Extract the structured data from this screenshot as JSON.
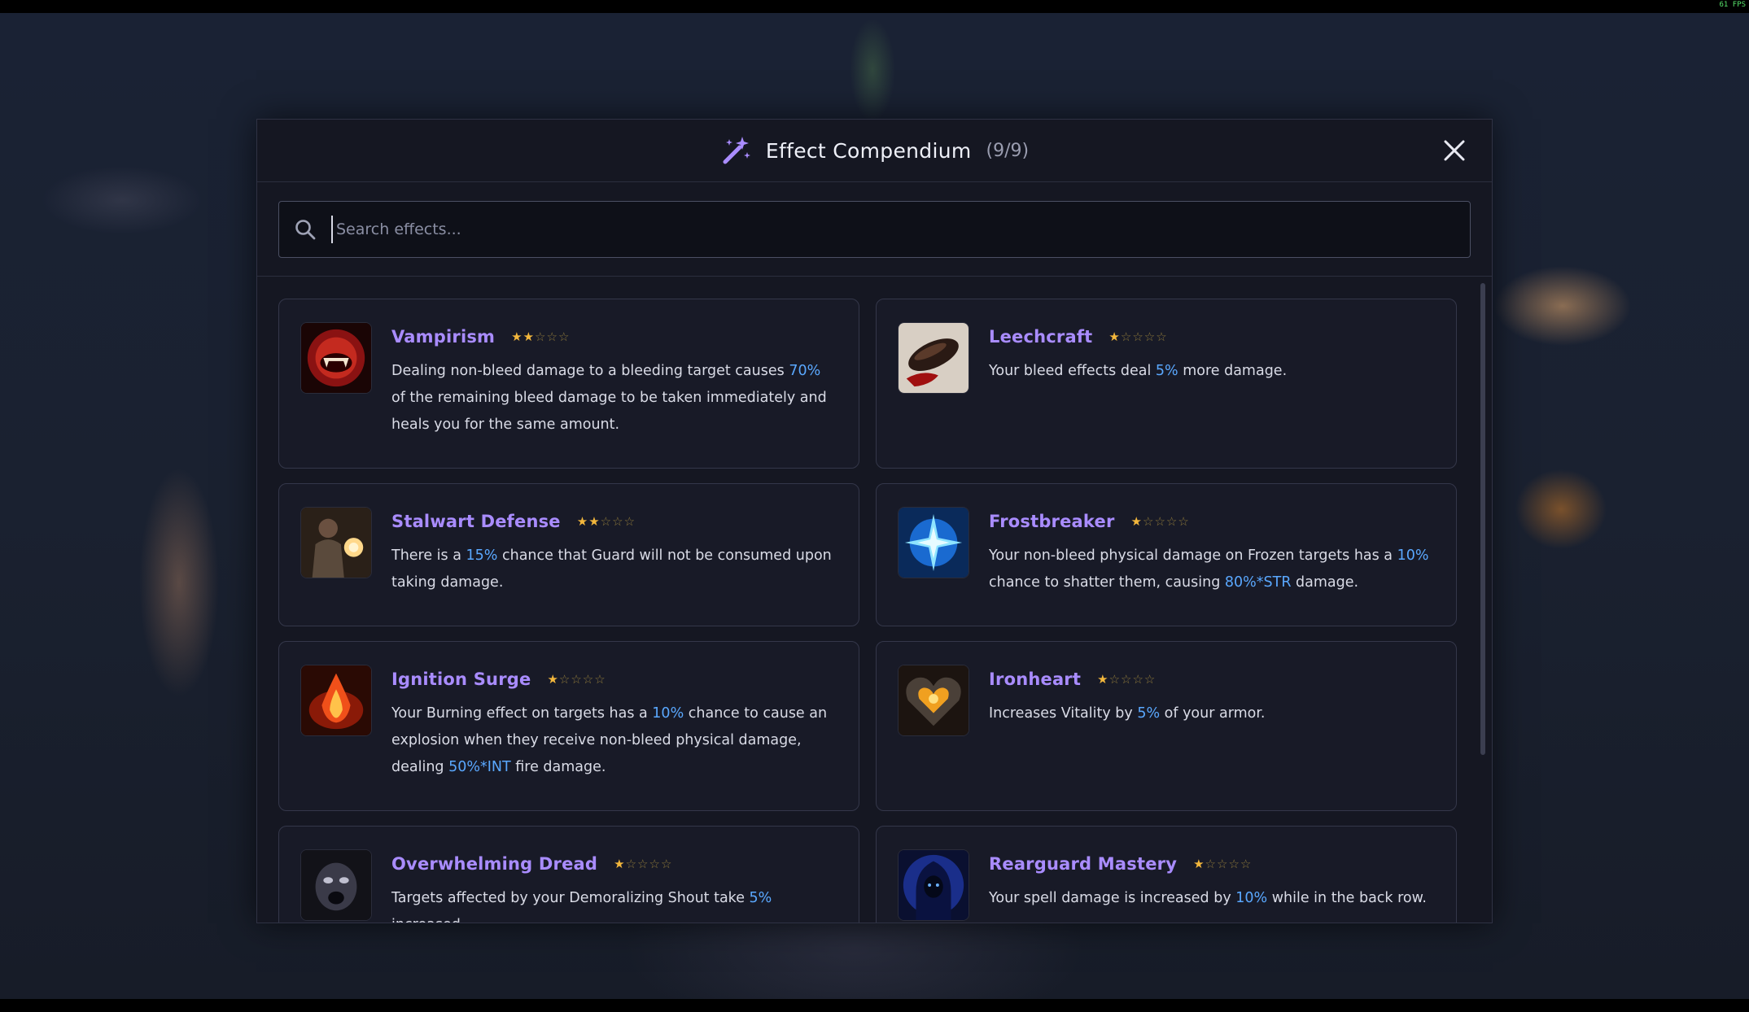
{
  "fps": "61 FPS",
  "modal": {
    "title": "Effect Compendium",
    "count": "(9/9)",
    "close_icon": "close-icon",
    "header_icon": "magic-wand-icon"
  },
  "search": {
    "placeholder": "Search effects...",
    "value": ""
  },
  "colors": {
    "accent_title": "#a98cff",
    "highlight": "#5aa8ff",
    "star": "#f3b73c"
  },
  "effects": [
    {
      "name": "Vampirism",
      "stars_filled": 2,
      "stars_total": 5,
      "icon": "vampire-fangs-icon",
      "desc": [
        "Dealing non-bleed damage to a bleeding target causes ",
        "70%",
        " of the remaining bleed damage to be taken immediately and heals you for the same amount."
      ]
    },
    {
      "name": "Leechcraft",
      "stars_filled": 1,
      "stars_total": 5,
      "icon": "leech-icon",
      "desc": [
        "Your bleed effects deal ",
        "5%",
        " more damage."
      ]
    },
    {
      "name": "Stalwart Defense",
      "stars_filled": 2,
      "stars_total": 5,
      "icon": "armored-knight-icon",
      "desc": [
        "There is a ",
        "15%",
        " chance that Guard will not be consumed upon taking damage."
      ]
    },
    {
      "name": "Frostbreaker",
      "stars_filled": 1,
      "stars_total": 5,
      "icon": "ice-shatter-icon",
      "desc": [
        "Your non-bleed physical damage on Frozen targets has a ",
        "10%",
        " chance to shatter them, causing ",
        "80%*STR",
        " damage."
      ]
    },
    {
      "name": "Ignition Surge",
      "stars_filled": 1,
      "stars_total": 5,
      "icon": "fire-explosion-icon",
      "desc": [
        "Your Burning effect on targets has a ",
        "10%",
        " chance to cause an explosion when they receive non-bleed physical damage, dealing ",
        "50%*INT",
        " fire damage."
      ]
    },
    {
      "name": "Ironheart",
      "stars_filled": 1,
      "stars_total": 5,
      "icon": "iron-heart-icon",
      "desc": [
        "Increases Vitality by ",
        "5%",
        " of your armor."
      ]
    },
    {
      "name": "Overwhelming Dread",
      "stars_filled": 1,
      "stars_total": 5,
      "icon": "dread-face-icon",
      "desc": [
        "Targets affected by your Demoralizing Shout take ",
        "5%",
        " increased"
      ]
    },
    {
      "name": "Rearguard Mastery",
      "stars_filled": 1,
      "stars_total": 5,
      "icon": "hooded-mage-icon",
      "desc": [
        "Your spell damage is increased by ",
        "10%",
        " while in the back row."
      ]
    }
  ]
}
